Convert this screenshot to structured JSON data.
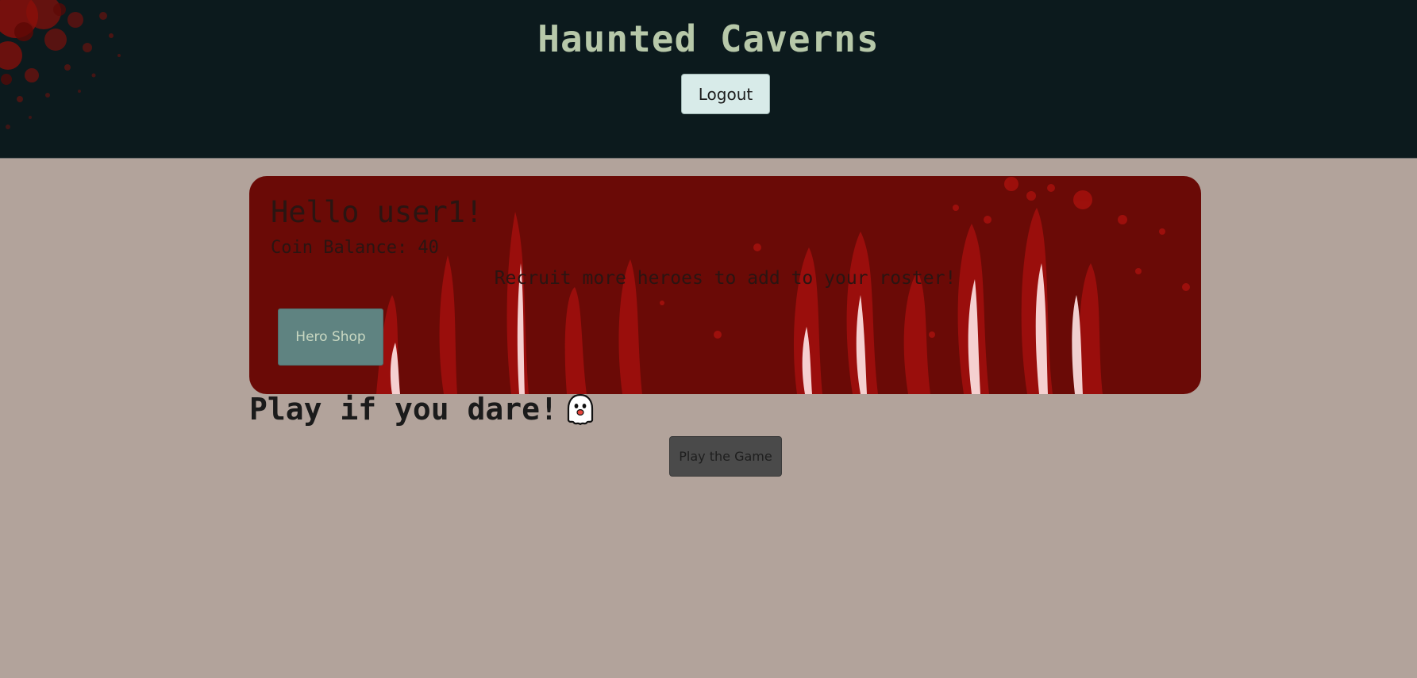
{
  "header": {
    "title": "Haunted Caverns",
    "logout_label": "Logout"
  },
  "banner": {
    "greeting": "Hello user1!",
    "coin_balance": "Coin Balance: 40",
    "recruit_text": "Recruit more heroes to add to your roster!",
    "hero_shop_label": "Hero Shop"
  },
  "play": {
    "heading": "Play if you dare!",
    "ghost_icon": "ghost-emoji-icon",
    "play_label": "Play the Game"
  },
  "colors": {
    "header_bg": "#0c1a1d",
    "page_bg": "#b2a39b",
    "banner_bg": "#6a0a06",
    "title_color": "#b7c8a9",
    "hero_shop_bg": "#5f8381",
    "play_button_bg": "#4a4a4a"
  }
}
